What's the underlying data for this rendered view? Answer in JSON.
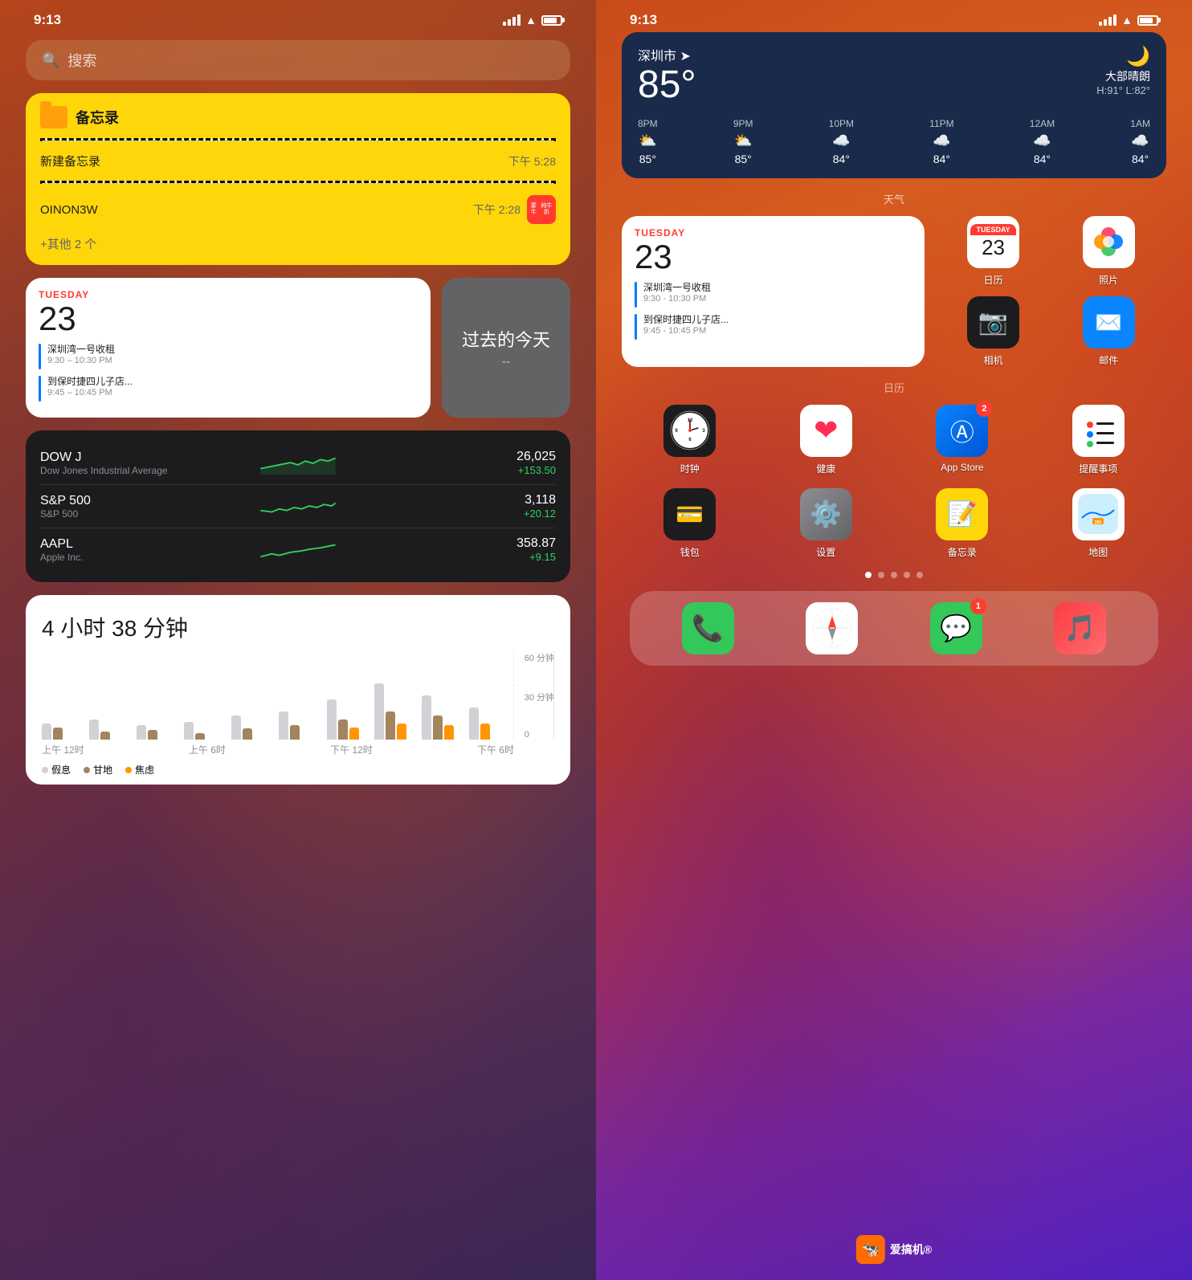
{
  "left": {
    "status": {
      "time": "9:13"
    },
    "search": {
      "placeholder": "搜索",
      "icon": "🔍"
    },
    "notes_widget": {
      "title": "备忘录",
      "items": [
        {
          "name": "新建备忘录",
          "time": "下午 5:28"
        },
        {
          "name": "OINON3W",
          "time": "下午 2:28"
        }
      ],
      "more": "+其他 2 个"
    },
    "calendar_widget": {
      "day_label": "TUESDAY",
      "date": "23",
      "events": [
        {
          "title": "深圳湾一号收租",
          "time": "9:30 – 10:30 PM"
        },
        {
          "title": "到保时捷四儿子店...",
          "time": "9:45 – 10:45 PM"
        }
      ]
    },
    "past_today": {
      "text": "过去的今天",
      "dash": "--"
    },
    "stocks": [
      {
        "name": "DOW J",
        "full": "Dow Jones Industrial Average",
        "price": "26,025",
        "change": "+153.50"
      },
      {
        "name": "S&P 500",
        "full": "S&P 500",
        "price": "3,118",
        "change": "+20.12"
      },
      {
        "name": "AAPL",
        "full": "Apple Inc.",
        "price": "358.87",
        "change": "+9.15"
      }
    ],
    "screentime": {
      "title": "4 小时 38 分钟",
      "y_labels": [
        "60 分钟",
        "30 分钟",
        "0"
      ],
      "x_labels": [
        "上午 12时",
        "上午 6时",
        "下午 12时",
        "下午 6时"
      ],
      "legend": [
        "假息",
        "甘地",
        "焦虑"
      ]
    }
  },
  "right": {
    "status": {
      "time": "9:13"
    },
    "weather": {
      "city": "深圳市",
      "temp": "85°",
      "condition": "大部晴朗",
      "range": "H:91° L:82°",
      "moon": "🌙",
      "hours": [
        {
          "time": "8PM",
          "icon": "⛅",
          "temp": "85°"
        },
        {
          "time": "9PM",
          "icon": "⛅",
          "temp": "85°"
        },
        {
          "time": "10PM",
          "icon": "☁️",
          "temp": "84°"
        },
        {
          "time": "11PM",
          "icon": "☁️",
          "temp": "84°"
        },
        {
          "time": "12AM",
          "icon": "☁️",
          "temp": "84°"
        },
        {
          "time": "1AM",
          "icon": "☁️",
          "temp": "84°"
        }
      ],
      "label": "天气"
    },
    "calendar_widget": {
      "day_label": "TUESDAY",
      "date": "23",
      "events": [
        {
          "title": "深圳湾一号收租",
          "time": "9:30 - 10:30 PM"
        },
        {
          "title": "到保时捷四儿子店...",
          "time": "9:45 - 10:45 PM"
        }
      ],
      "label": "日历"
    },
    "apps_row1": [
      {
        "name": "日历",
        "type": "calendar"
      },
      {
        "name": "照片",
        "type": "photos"
      },
      {
        "name": "相机",
        "type": "camera"
      },
      {
        "name": "邮件",
        "type": "mail"
      }
    ],
    "apps_row2": [
      {
        "name": "时钟",
        "type": "clock"
      },
      {
        "name": "健康",
        "type": "health"
      },
      {
        "name": "App Store",
        "type": "appstore",
        "badge": "2"
      },
      {
        "name": "提醒事项",
        "type": "reminders"
      }
    ],
    "apps_row3": [
      {
        "name": "钱包",
        "type": "wallet"
      },
      {
        "name": "设置",
        "type": "settings"
      },
      {
        "name": "备忘录",
        "type": "notes"
      },
      {
        "name": "地图",
        "type": "maps"
      }
    ],
    "dock": [
      {
        "name": "电话",
        "type": "phone"
      },
      {
        "name": "Safari",
        "type": "safari"
      },
      {
        "name": "信息",
        "type": "messages",
        "badge": "1"
      },
      {
        "name": "音乐",
        "type": "music"
      }
    ],
    "page_dots": 5,
    "active_dot": 0
  }
}
